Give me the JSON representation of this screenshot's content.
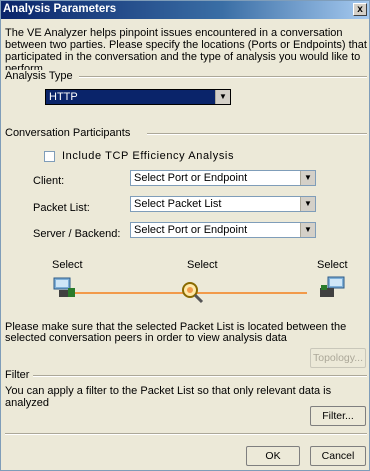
{
  "window": {
    "title": "Analysis Parameters",
    "close_glyph": "x"
  },
  "intro_text": "The VE Analyzer helps pinpoint issues encountered in a conversation between two parties. Please specify the locations (Ports or Endpoints) that participated in the conversation and the type of analysis you would like to perform.",
  "analysis_type": {
    "group_label": "Analysis Type",
    "selected": "HTTP"
  },
  "participants": {
    "group_label": "Conversation Participants",
    "tcp_checkbox_label": "Include TCP Efficiency Analysis",
    "tcp_checked": false,
    "client_label": "Client:",
    "client_value": "Select Port or Endpoint",
    "packet_list_label": "Packet List:",
    "packet_list_value": "Select Packet List",
    "server_label": "Server / Backend:",
    "server_value": "Select Port or Endpoint",
    "diagram": {
      "left_label": "Select",
      "center_label": "Select",
      "right_label": "Select"
    },
    "note": "Please make sure that the selected Packet List is located between the selected conversation peers in order to view analysis data",
    "topology_button": "Topology..."
  },
  "filter": {
    "group_label": "Filter",
    "description": "You can apply a filter to the Packet List so that only relevant data is analyzed",
    "filter_button": "Filter..."
  },
  "footer": {
    "ok_button": "OK",
    "cancel_button": "Cancel"
  },
  "colors": {
    "title_bar": "#0a246a",
    "accent_line": "#f29a4a",
    "dialog_bg": "#ece9d8"
  },
  "icons": [
    "client-computer-icon",
    "packet-list-magnifier-icon",
    "server-computer-icon",
    "dropdown-arrow-icon"
  ]
}
